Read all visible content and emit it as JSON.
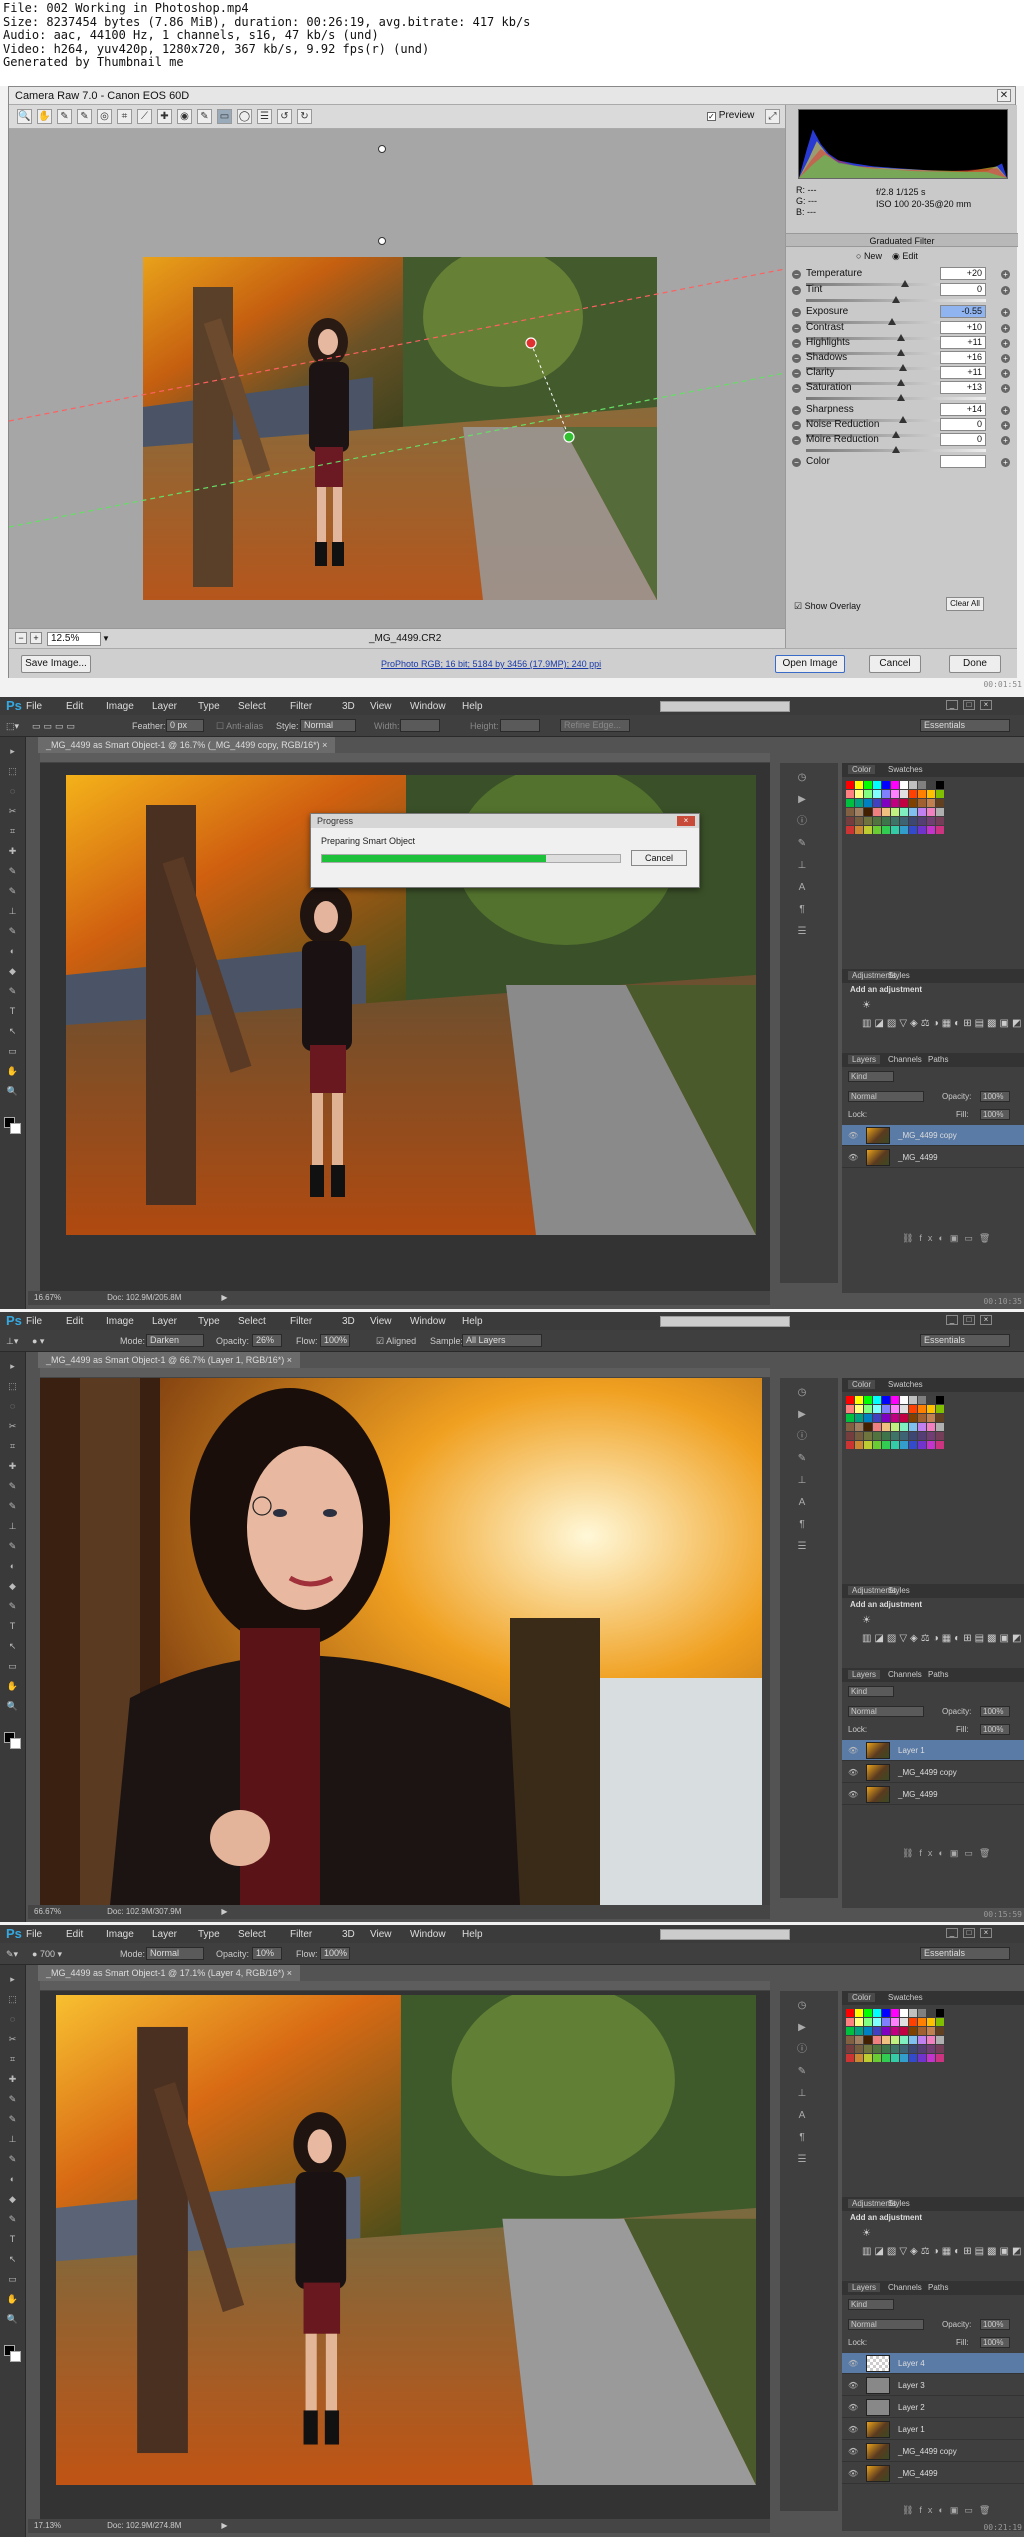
{
  "file_header": {
    "lines": [
      "File: 002 Working in Photoshop.mp4",
      "Size: 8237454 bytes (7.86 MiB), duration: 00:26:19, avg.bitrate: 417 kb/s",
      "Audio: aac, 44100 Hz, 1 channels, s16, 47 kb/s (und)",
      "Video: h264, yuv420p, 1280x720, 367 kb/s, 9.92 fps(r) (und)",
      "Generated by Thumbnail me"
    ]
  },
  "camera_raw": {
    "title": "Camera Raw 7.0  -  Canon EOS 60D",
    "close": "✕",
    "preview_label": "Preview",
    "toolbar_icons": [
      "zoom-icon",
      "hand-icon",
      "white-balance-icon",
      "color-sampler-icon",
      "target-adjust-icon",
      "crop-icon",
      "straighten-icon",
      "spot-removal-icon",
      "red-eye-icon",
      "adjustment-brush-icon",
      "graduated-filter-icon",
      "radial-icon",
      "list-icon",
      "rotate-left-icon",
      "rotate-right-icon"
    ],
    "toolbar_glyphs": [
      "🔍",
      "✋",
      "✎",
      "✎",
      "◎",
      "⌗",
      "⟋",
      "✚",
      "◉",
      "✎",
      "▭",
      "◯",
      "☰",
      "↺",
      "↻"
    ],
    "zoom_value": "12.5%",
    "filename": "_MG_4499.CR2",
    "camera_info": {
      "rgb": [
        "R:  ---",
        "G:  ---",
        "B:  ---"
      ],
      "exposure": "f/2.8   1/125 s",
      "iso": "ISO 100   20-35@20 mm"
    },
    "panel_title": "Graduated Filter",
    "mode_new": "New",
    "mode_edit": "Edit",
    "sliders": [
      {
        "label": "Temperature",
        "value": "+20",
        "pos": 0.55
      },
      {
        "label": "Tint",
        "value": "0",
        "pos": 0.5
      },
      {
        "label": "Exposure",
        "value": "-0.55",
        "pos": 0.48
      },
      {
        "label": "Contrast",
        "value": "+10",
        "pos": 0.53
      },
      {
        "label": "Highlights",
        "value": "+11",
        "pos": 0.53
      },
      {
        "label": "Shadows",
        "value": "+16",
        "pos": 0.54
      },
      {
        "label": "Clarity",
        "value": "+11",
        "pos": 0.53
      },
      {
        "label": "Saturation",
        "value": "+13",
        "pos": 0.53
      },
      {
        "label": "Sharpness",
        "value": "+14",
        "pos": 0.54
      },
      {
        "label": "Noise Reduction",
        "value": "0",
        "pos": 0.5
      },
      {
        "label": "Moire Reduction",
        "value": "0",
        "pos": 0.5
      },
      {
        "label": "Color",
        "value": "",
        "pos": null
      }
    ],
    "show_overlay": "Show Overlay",
    "clear_all": "Clear All",
    "save_image": "Save Image...",
    "workflow_link": "ProPhoto RGB; 16 bit; 5184 by 3456 (17.9MP); 240 ppi",
    "open_image": "Open Image",
    "cancel": "Cancel",
    "done": "Done",
    "timestamp": "00:01:51"
  },
  "ps_common": {
    "menu": [
      "File",
      "Edit",
      "Image",
      "Layer",
      "Type",
      "Select",
      "Filter",
      "3D",
      "View",
      "Window",
      "Help"
    ],
    "workspace": "Essentials",
    "panel_tabs": {
      "color": "Color",
      "swatches": "Swatches",
      "adjustments": "Adjustments",
      "styles": "Styles",
      "layers": "Layers",
      "channels": "Channels",
      "paths": "Paths"
    },
    "add_adjustment": "Add an adjustment",
    "kind": "Kind",
    "blend": "Normal",
    "opacity_label": "Opacity:",
    "opacity_value": "100%",
    "lock_label": "Lock:",
    "fill_label": "Fill:",
    "fill_value": "100%",
    "swatch_colors": [
      "#ff0000",
      "#ffff00",
      "#00ff00",
      "#00ffff",
      "#0000ff",
      "#ff00ff",
      "#ffffff",
      "#c0c0c0",
      "#808080",
      "#404040",
      "#000000",
      "#ff8080",
      "#ffff80",
      "#80ff80",
      "#80ffff",
      "#8080ff",
      "#ff80ff",
      "#e0e0e0",
      "#ff4000",
      "#ff8000",
      "#ffc000",
      "#80c000",
      "#00c040",
      "#00a080",
      "#0080c0",
      "#4040c0",
      "#8000c0",
      "#c00080",
      "#c00040",
      "#804000",
      "#a06030",
      "#c08050",
      "#604020",
      "#806040",
      "#a08060",
      "#402000",
      "#f08080",
      "#f0c080",
      "#c0f080",
      "#80f0c0",
      "#80c0f0",
      "#c080f0",
      "#f080c0",
      "#b0b0b0"
    ]
  },
  "ps1": {
    "doc_tab": "_MG_4499 as Smart Object-1 @ 16.7% (_MG_4499 copy, RGB/16*)  ×",
    "options": {
      "feather_label": "Feather:",
      "feather_value": "0 px",
      "anti_alias": "Anti-alias",
      "style_label": "Style:",
      "style_value": "Normal",
      "width_label": "Width:",
      "height_label": "Height:",
      "refine": "Refine Edge..."
    },
    "progress_title": "Progress",
    "progress_text": "Preparing Smart Object",
    "progress_value": 0.75,
    "progress_cancel": "Cancel",
    "status_zoom": "16.67%",
    "status_doc": "Doc: 102.9M/205.8M",
    "layers": [
      {
        "name": "_MG_4499 copy",
        "selected": true
      },
      {
        "name": "_MG_4499",
        "selected": false
      }
    ],
    "timestamp": "00:10:35"
  },
  "ps2": {
    "doc_tab": "_MG_4499 as Smart Object-1 @ 66.7% (Layer 1, RGB/16*)  ×",
    "options": {
      "mode_label": "Mode:",
      "mode_value": "Darken",
      "opacity_label": "Opacity:",
      "opacity_value": "26%",
      "flow_label": "Flow:",
      "flow_value": "100%",
      "aligned": "Aligned",
      "sample_label": "Sample:",
      "sample_value": "All Layers"
    },
    "status_zoom": "66.67%",
    "status_doc": "Doc: 102.9M/307.9M",
    "layers": [
      {
        "name": "Layer 1",
        "selected": true
      },
      {
        "name": "_MG_4499 copy",
        "selected": false
      },
      {
        "name": "_MG_4499",
        "selected": false
      }
    ],
    "timestamp": "00:15:59"
  },
  "ps3": {
    "doc_tab": "_MG_4499 as Smart Object-1 @ 17.1% (Layer 4, RGB/16*)  ×",
    "options": {
      "size": "700",
      "mode_label": "Mode:",
      "mode_value": "Normal",
      "opacity_label": "Opacity:",
      "opacity_value": "10%",
      "flow_label": "Flow:",
      "flow_value": "100%"
    },
    "status_zoom": "17.13%",
    "status_doc": "Doc: 102.9M/274.8M",
    "layers": [
      {
        "name": "Layer 4",
        "selected": true,
        "kind": "empty"
      },
      {
        "name": "Layer 3",
        "selected": false,
        "kind": "gray"
      },
      {
        "name": "Layer 2",
        "selected": false,
        "kind": "gray"
      },
      {
        "name": "Layer 1",
        "selected": false,
        "kind": "photo"
      },
      {
        "name": "_MG_4499 copy",
        "selected": false,
        "kind": "photo"
      },
      {
        "name": "_MG_4499",
        "selected": false,
        "kind": "photo"
      }
    ],
    "timestamp": "00:21:19"
  }
}
